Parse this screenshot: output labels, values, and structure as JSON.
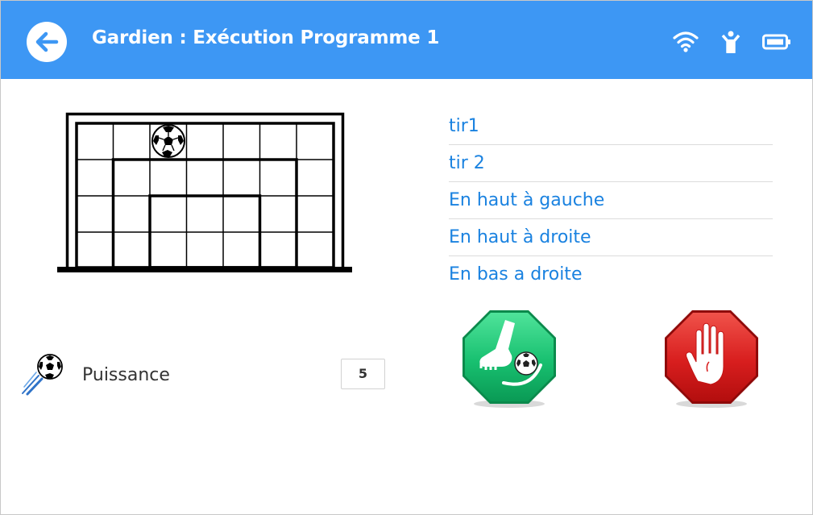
{
  "header": {
    "title": "Gardien : Exécution Programme 1",
    "status_icons": [
      "wifi-icon",
      "person-icon",
      "battery-icon"
    ],
    "color": "#3d97f4"
  },
  "programs": {
    "items": [
      {
        "label": "tir1"
      },
      {
        "label": "tir 2"
      },
      {
        "label": "En haut à gauche"
      },
      {
        "label": "En haut à droite"
      },
      {
        "label": "En bas a droite"
      }
    ]
  },
  "power": {
    "label": "Puissance",
    "value": "5",
    "icon": "flying-ball-icon"
  },
  "actions": {
    "kick_icon": "kick-icon",
    "stop_icon": "stop-hand-icon"
  },
  "goal": {
    "ball_icon": "soccer-ball-icon"
  }
}
